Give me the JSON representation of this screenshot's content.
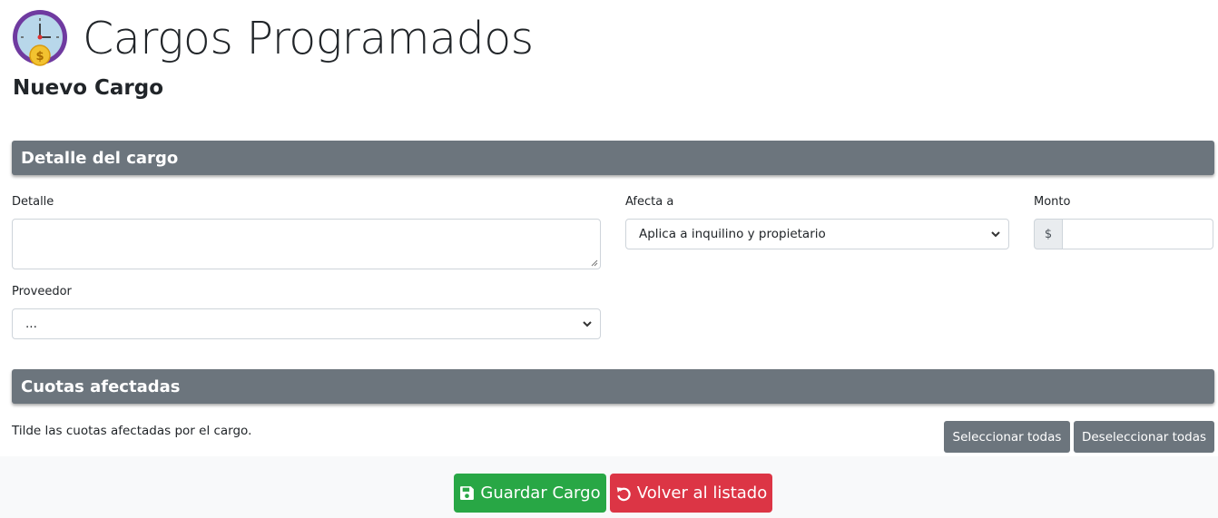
{
  "colors": {
    "section_bar": "#6c757d",
    "save": "#28a745",
    "back": "#dc3545",
    "logo_ring": "#6f3aa0",
    "logo_face": "#b8d7ea",
    "coin": "#f2c230"
  },
  "header": {
    "title": "Cargos Programados",
    "subtitle": "Nuevo Cargo",
    "logo_icon": "clock-coin-icon"
  },
  "detalle_section": {
    "title": "Detalle del cargo",
    "detalle_label": "Detalle",
    "detalle_value": "",
    "afecta_label": "Afecta a",
    "afecta_selected": "Aplica a inquilino y propietario",
    "monto_label": "Monto",
    "monto_prefix": "$",
    "monto_value": "",
    "proveedor_label": "Proveedor",
    "proveedor_selected": "..."
  },
  "cuotas_section": {
    "title": "Cuotas afectadas",
    "hint": "Tilde las cuotas afectadas por el cargo.",
    "select_all": "Seleccionar todas",
    "deselect_all": "Deseleccionar todas"
  },
  "footer": {
    "save_label": "Guardar Cargo",
    "save_icon": "floppy-disk-icon",
    "back_label": "Volver al listado",
    "back_icon": "undo-arrow-icon"
  }
}
